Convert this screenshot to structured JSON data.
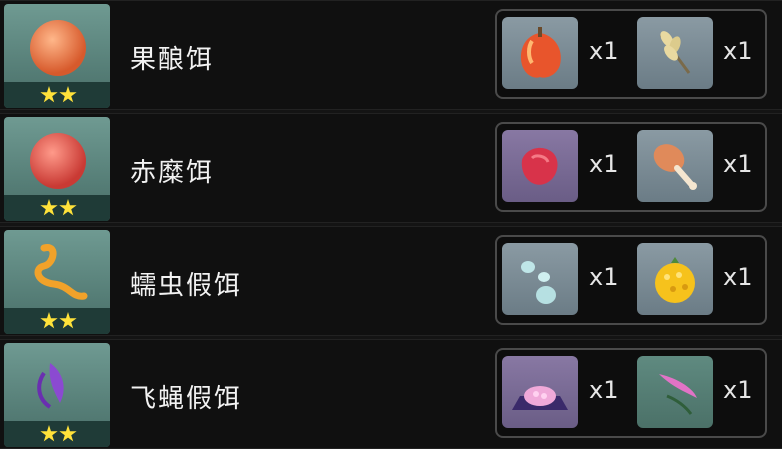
{
  "baits": [
    {
      "name": "果酿饵",
      "stars": 2,
      "materials": [
        {
          "icon": "apple-icon",
          "qty": "x1"
        },
        {
          "icon": "wheat-icon",
          "qty": "x1"
        }
      ]
    },
    {
      "name": "赤糜饵",
      "stars": 2,
      "materials": [
        {
          "icon": "raw-meat-icon",
          "qty": "x1"
        },
        {
          "icon": "drumstick-icon",
          "qty": "x1"
        }
      ]
    },
    {
      "name": "蠕虫假饵",
      "stars": 2,
      "materials": [
        {
          "icon": "slime-drops-icon",
          "qty": "x1"
        },
        {
          "icon": "golden-fruit-icon",
          "qty": "x1"
        }
      ]
    },
    {
      "name": "飞蝇假饵",
      "stars": 2,
      "materials": [
        {
          "icon": "crystal-flower-icon",
          "qty": "x1"
        },
        {
          "icon": "pink-feather-icon",
          "qty": "x1"
        }
      ]
    }
  ],
  "colors": {
    "star": "#ffe23a",
    "icon_bg": "#6f9a92",
    "text": "#f2f2f2"
  }
}
